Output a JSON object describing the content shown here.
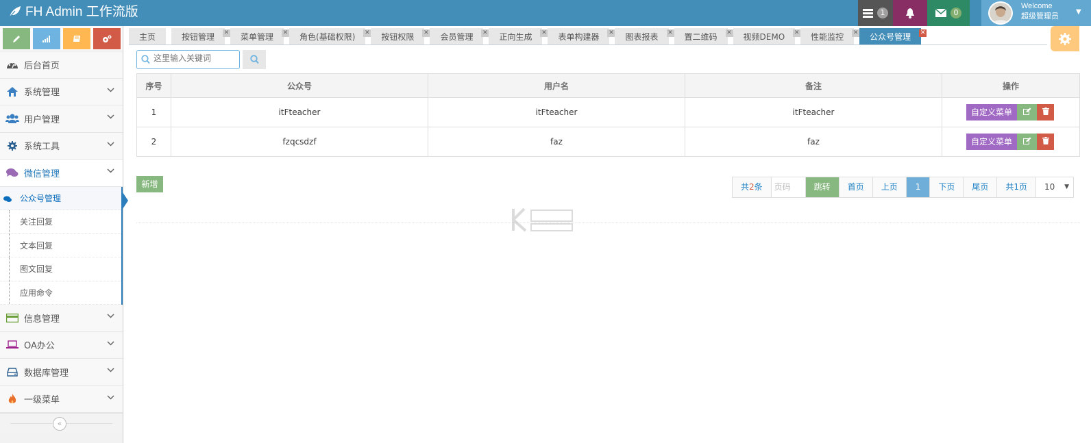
{
  "header": {
    "brand": "FH Admin 工作流版",
    "badges": [
      {
        "icon": "task-list-icon",
        "count": "1",
        "color": "#555555",
        "badge_color": "#a0a0a0"
      },
      {
        "icon": "bell-icon",
        "count": "",
        "color": "#892e65"
      },
      {
        "icon": "envelope-icon",
        "count": "0",
        "color": "#2e8965",
        "badge_color": "#82af6f"
      }
    ],
    "user": {
      "welcome": "Welcome",
      "name": "超级管理员"
    }
  },
  "sidebar": {
    "shortcuts": [
      {
        "icon": "pencil-icon",
        "color": "#87b87f"
      },
      {
        "icon": "signal-icon",
        "color": "#6fb3e0"
      },
      {
        "icon": "book-icon",
        "color": "#ffb752"
      },
      {
        "icon": "cogs-icon",
        "color": "#d15b47"
      }
    ],
    "items": [
      {
        "label": "后台首页",
        "icon": "dashboard-icon"
      },
      {
        "label": "系统管理",
        "icon": "home-icon"
      },
      {
        "label": "用户管理",
        "icon": "users-icon"
      },
      {
        "label": "系统工具",
        "icon": "gear-icon"
      },
      {
        "label": "微信管理",
        "icon": "comments-icon"
      },
      {
        "label": "信息管理",
        "icon": "credit-card-icon"
      },
      {
        "label": "OA办公",
        "icon": "laptop-icon"
      },
      {
        "label": "数据库管理",
        "icon": "hdd-icon"
      },
      {
        "label": "一级菜单",
        "icon": "fire-icon"
      }
    ],
    "wechat_sub": [
      {
        "label": "公众号管理"
      },
      {
        "label": "关注回复"
      },
      {
        "label": "文本回复"
      },
      {
        "label": "图文回复"
      },
      {
        "label": "应用命令"
      }
    ]
  },
  "tabs": [
    {
      "label": "主页"
    },
    {
      "label": "按钮管理"
    },
    {
      "label": "菜单管理"
    },
    {
      "label": "角色(基础权限)"
    },
    {
      "label": "按钮权限"
    },
    {
      "label": "会员管理"
    },
    {
      "label": "正向生成"
    },
    {
      "label": "表单构建器"
    },
    {
      "label": "图表报表"
    },
    {
      "label": "置二维码"
    },
    {
      "label": "视频DEMO"
    },
    {
      "label": "性能监控"
    },
    {
      "label": "公众号管理"
    }
  ],
  "search": {
    "placeholder": "这里输入关键词"
  },
  "table": {
    "headers": [
      "序号",
      "公众号",
      "用户名",
      "备注",
      "操作"
    ],
    "rows": [
      [
        "1",
        "itFteacher",
        "itFteacher",
        "itFteacher"
      ],
      [
        "2",
        "fzqcsdzf",
        "faz",
        "faz"
      ]
    ],
    "custom_menu_label": "自定义菜单"
  },
  "actions": {
    "add_label": "新增"
  },
  "pager": {
    "total_prefix": "共",
    "total_count": "2",
    "total_suffix": "条",
    "page_input_placeholder": "页码",
    "jump": "跳转",
    "first": "首页",
    "prev": "上页",
    "current": "1",
    "next": "下页",
    "last": "尾页",
    "pages": "共1页",
    "page_size": "10"
  }
}
